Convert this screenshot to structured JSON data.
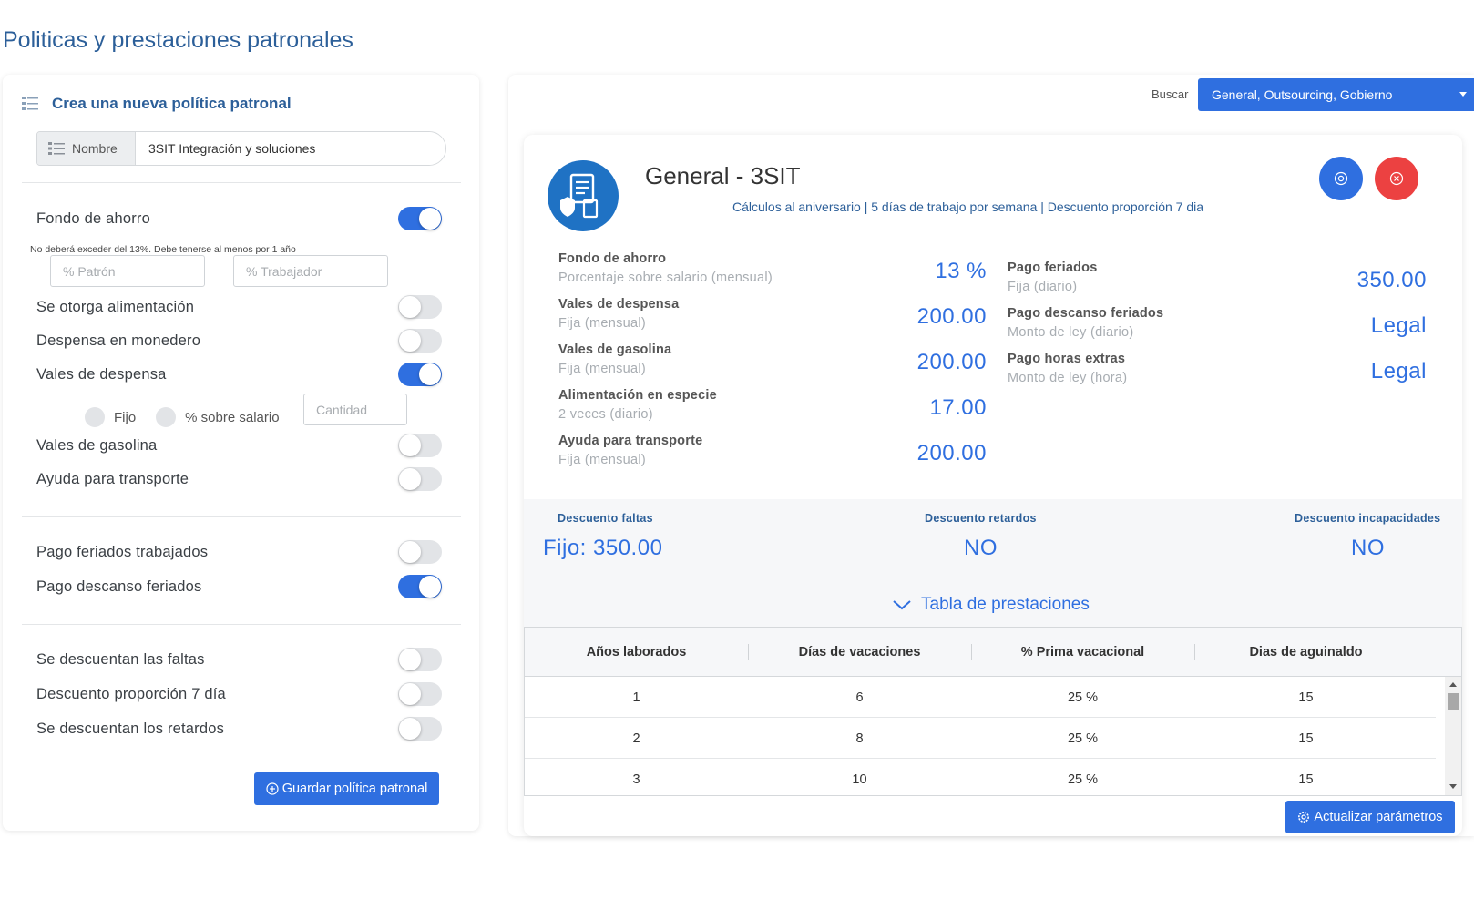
{
  "page": {
    "title": "Politicas y prestaciones patronales"
  },
  "create": {
    "header": "Crea una nueva política patronal",
    "name_label": "Nombre",
    "name_value": "3SIT Integración y soluciones",
    "options": [
      {
        "label": "Fondo de ahorro",
        "on": true
      },
      {
        "label": "Se otorga alimentación",
        "on": false
      },
      {
        "label": "Despensa en monedero",
        "on": false
      },
      {
        "label": "Vales de despensa",
        "on": true
      },
      {
        "label": "Vales de gasolina",
        "on": false
      },
      {
        "label": "Ayuda para transporte",
        "on": false
      },
      {
        "label": "Pago feriados trabajados",
        "on": false
      },
      {
        "label": "Pago descanso feriados",
        "on": true
      },
      {
        "label": "Se descuentan las faltas",
        "on": false
      },
      {
        "label": "Descuento proporción 7 día",
        "on": false
      },
      {
        "label": "Se descuentan los retardos",
        "on": false
      }
    ],
    "fondo_hint": "No deberá exceder del 13%. Debe tenerse al menos por 1 año",
    "patron_placeholder": "% Patrón",
    "trabajador_placeholder": "% Trabajador",
    "radio_fijo": "Fijo",
    "radio_salario": "% sobre salario",
    "cantidad_placeholder": "Cantidad",
    "save_button": "Guardar política patronal"
  },
  "search": {
    "label": "Buscar",
    "value": "General, Outsourcing, Gobierno"
  },
  "policy": {
    "title": "General - 3SIT",
    "subtitle": "Cálculos al aniversario | 5 días de trabajo por semana | Descuento proporción 7 dia",
    "benefits_left": [
      {
        "name": "Fondo de ahorro",
        "desc": "Porcentaje sobre salario (mensual)",
        "value": "13 %"
      },
      {
        "name": "Vales de despensa",
        "desc": "Fija (mensual)",
        "value": "200.00"
      },
      {
        "name": "Vales de gasolina",
        "desc": "Fija (mensual)",
        "value": "200.00"
      },
      {
        "name": "Alimentación en especie",
        "desc": "2 veces (diario)",
        "value": "17.00"
      },
      {
        "name": "Ayuda para transporte",
        "desc": "Fija (mensual)",
        "value": "200.00"
      }
    ],
    "benefits_right": [
      {
        "name": "Pago feriados",
        "desc": "Fija (diario)",
        "value": "350.00"
      },
      {
        "name": "Pago descanso feriados",
        "desc": "Monto de ley (diario)",
        "value": "Legal"
      },
      {
        "name": "Pago horas extras",
        "desc": "Monto de ley (hora)",
        "value": "Legal"
      }
    ],
    "discounts": [
      {
        "label": "Descuento faltas",
        "value": "Fijo: 350.00"
      },
      {
        "label": "Descuento retardos",
        "value": "NO"
      },
      {
        "label": "Descuento incapacidades",
        "value": "NO"
      }
    ],
    "tabla_label": "Tabla de prestaciones",
    "table": {
      "columns": [
        "Años laborados",
        "Días de vacaciones",
        "% Prima vacacional",
        "Dias de aguinaldo"
      ],
      "rows": [
        [
          "1",
          "6",
          "25 %",
          "15"
        ],
        [
          "2",
          "8",
          "25 %",
          "15"
        ],
        [
          "3",
          "10",
          "25 %",
          "15"
        ]
      ]
    },
    "update_button": "Actualizar parámetros"
  },
  "colors": {
    "accent": "#2f6fe0",
    "title": "#2c5f99",
    "danger": "#ec4141",
    "icon_circle": "#1f72c4"
  }
}
